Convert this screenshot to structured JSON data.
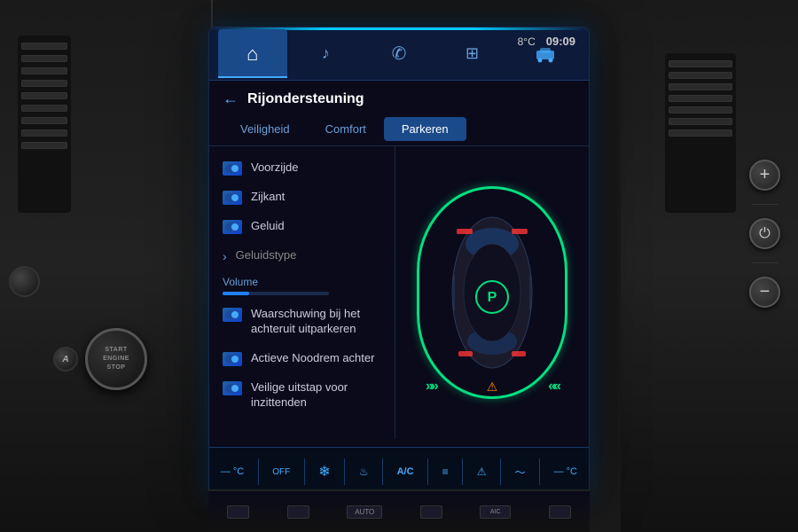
{
  "screen": {
    "title": "Rijondersteuning",
    "status": {
      "temperature": "8°C",
      "time": "09:09"
    },
    "nav_tabs": [
      {
        "id": "home",
        "icon": "⌂",
        "label": "Home"
      },
      {
        "id": "media",
        "icon": "♪",
        "label": "Media"
      },
      {
        "id": "phone",
        "icon": "✆",
        "label": "Phone"
      },
      {
        "id": "apps",
        "icon": "⊞",
        "label": "Apps"
      },
      {
        "id": "car",
        "icon": "🚗",
        "label": "Car",
        "active": true
      }
    ],
    "sub_tabs": [
      {
        "label": "Veiligheid",
        "active": false
      },
      {
        "label": "Comfort",
        "active": false
      },
      {
        "label": "Parkeren",
        "active": true
      }
    ],
    "menu_items": [
      {
        "icon": true,
        "label": "Voorzijde",
        "type": "toggle"
      },
      {
        "icon": true,
        "label": "Zijkant",
        "type": "toggle"
      },
      {
        "icon": true,
        "label": "Geluid",
        "type": "toggle"
      },
      {
        "icon": false,
        "label": "Geluidstype",
        "type": "arrow"
      },
      {
        "icon": true,
        "label": "Waarschuwing bij het achteruit uitparkeren",
        "type": "toggle"
      },
      {
        "icon": true,
        "label": "Actieve Noodrem achter",
        "type": "toggle"
      },
      {
        "icon": true,
        "label": "Veilige uitstap voor inzittenden",
        "type": "toggle"
      }
    ],
    "volume": {
      "label": "Volume",
      "fill_percent": 25
    },
    "bottom_bar": [
      {
        "icon": "—°C",
        "label": ""
      },
      {
        "icon": "OFF",
        "label": ""
      },
      {
        "icon": "❄",
        "label": ""
      },
      {
        "icon": "♨",
        "label": ""
      },
      {
        "icon": "A/C",
        "label": ""
      },
      {
        "icon": "≡≡",
        "label": ""
      },
      {
        "icon": "⚠",
        "label": ""
      },
      {
        "icon": "〜",
        "label": ""
      },
      {
        "icon": "—°C",
        "label": ""
      }
    ],
    "car_visual": {
      "oval_color": "#00e080",
      "arrows_left": "»»",
      "arrows_right": "««",
      "warning_icon": "⚠"
    }
  },
  "controls": {
    "plus_label": "+",
    "power_label": "⏻",
    "minus_label": "−"
  },
  "start_stop": {
    "label": "START\nENGINE\nSTOP",
    "a_label": "A"
  },
  "back_arrow": "←"
}
